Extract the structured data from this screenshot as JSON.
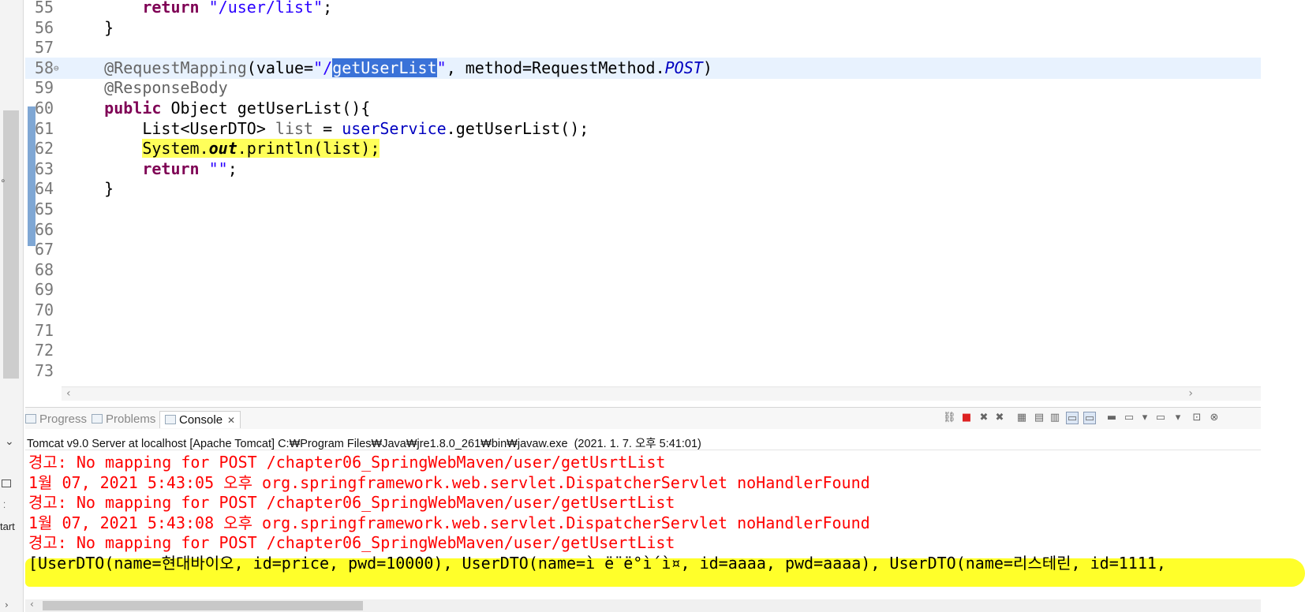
{
  "editor": {
    "lines": [
      {
        "num": "55",
        "segments": [
          {
            "t": "        ",
            "c": ""
          },
          {
            "t": "return",
            "c": "kw"
          },
          {
            "t": " ",
            "c": ""
          },
          {
            "t": "\"/user/list\"",
            "c": "str"
          },
          {
            "t": ";",
            "c": ""
          }
        ]
      },
      {
        "num": "56",
        "segments": [
          {
            "t": "    }",
            "c": ""
          }
        ]
      },
      {
        "num": "57",
        "segments": []
      },
      {
        "num": "58",
        "segments": [
          {
            "t": "    ",
            "c": ""
          },
          {
            "t": "@RequestMapping",
            "c": "ann"
          },
          {
            "t": "(value=",
            "c": ""
          },
          {
            "t": "\"/",
            "c": "str"
          },
          {
            "t": "getUserList",
            "c": "sel"
          },
          {
            "t": "\"",
            "c": "str"
          },
          {
            "t": ", method=RequestMethod.",
            "c": ""
          },
          {
            "t": "POST",
            "c": "stat"
          },
          {
            "t": ")",
            "c": ""
          }
        ]
      },
      {
        "num": "59",
        "segments": [
          {
            "t": "    ",
            "c": ""
          },
          {
            "t": "@ResponseBody",
            "c": "ann"
          }
        ]
      },
      {
        "num": "60",
        "segments": [
          {
            "t": "    ",
            "c": ""
          },
          {
            "t": "public",
            "c": "kw"
          },
          {
            "t": " Object getUserList(){",
            "c": ""
          }
        ]
      },
      {
        "num": "61",
        "segments": [
          {
            "t": "        List<UserDTO> ",
            "c": ""
          },
          {
            "t": "list",
            "c": "ann"
          },
          {
            "t": " = ",
            "c": ""
          },
          {
            "t": "userService",
            "c": "fld"
          },
          {
            "t": ".getUserList();",
            "c": ""
          }
        ]
      },
      {
        "num": "62",
        "segments": [
          {
            "t": "        ",
            "c": ""
          },
          {
            "t": "System.",
            "c": "hl-yellow"
          },
          {
            "t": "out",
            "c": "hl-yellow static-m"
          },
          {
            "t": ".println(list);",
            "c": "hl-yellow"
          }
        ]
      },
      {
        "num": "63",
        "segments": [
          {
            "t": "        ",
            "c": ""
          },
          {
            "t": "return",
            "c": "kw"
          },
          {
            "t": " ",
            "c": ""
          },
          {
            "t": "\"\"",
            "c": "str"
          },
          {
            "t": ";",
            "c": ""
          }
        ]
      },
      {
        "num": "64",
        "segments": [
          {
            "t": "    }",
            "c": ""
          }
        ]
      },
      {
        "num": "65",
        "segments": []
      },
      {
        "num": "66",
        "segments": []
      },
      {
        "num": "67",
        "segments": []
      },
      {
        "num": "68",
        "segments": []
      },
      {
        "num": "69",
        "segments": []
      },
      {
        "num": "70",
        "segments": []
      },
      {
        "num": "71",
        "segments": []
      },
      {
        "num": "72",
        "segments": []
      },
      {
        "num": "73",
        "segments": []
      }
    ],
    "current_line": "58",
    "fold_marker_line": "58",
    "fold_marker": "⊖"
  },
  "console": {
    "tabs": [
      {
        "label": "Progress",
        "active": false,
        "icon": "progress-icon"
      },
      {
        "label": "Problems",
        "active": false,
        "icon": "problems-icon"
      },
      {
        "label": "Console",
        "active": true,
        "icon": "console-icon"
      }
    ],
    "close_glyph": "✕",
    "launch_description": "Tomcat v9.0 Server at localhost [Apache Tomcat] C:₩Program Files₩Java₩jre1.8.0_261₩bin₩javaw.exe  (2021. 1. 7. 오후 5:41:01)",
    "output": [
      {
        "text": "경고: No mapping for POST /chapter06_SpringWebMaven/user/getUsrtList",
        "stream": "err"
      },
      {
        "text": "1월 07, 2021 5:43:05 오후 org.springframework.web.servlet.DispatcherServlet noHandlerFound",
        "stream": "err"
      },
      {
        "text": "경고: No mapping for POST /chapter06_SpringWebMaven/user/getUsertList",
        "stream": "err"
      },
      {
        "text": "1월 07, 2021 5:43:08 오후 org.springframework.web.servlet.DispatcherServlet noHandlerFound",
        "stream": "err"
      },
      {
        "text": "경고: No mapping for POST /chapter06_SpringWebMaven/user/getUsertList",
        "stream": "err"
      },
      {
        "text": "[UserDTO(name=현대바이오, id=price, pwd=10000), UserDTO(name=ì ë¨ë°ì´ì¤, id=aaaa, pwd=aaaa), UserDTO(name=리스테린, id=1111,",
        "stream": "out"
      }
    ],
    "toolbar_icons": [
      "remove-launch-icon",
      "terminate-icon",
      "remove-all-terminated-icon",
      "remove-all-icon",
      "clear-console-icon",
      "scroll-lock-icon",
      "word-wrap-icon",
      "show-stdout-icon",
      "show-stderr-icon",
      "pin-console-icon",
      "display-console-icon",
      "display-console-dropdown-icon",
      "open-console-icon",
      "open-console-dropdown-icon",
      "minimize-icon",
      "maximize-icon"
    ]
  },
  "left_strip": {
    "label": "tart"
  },
  "colors": {
    "stderr": "#ff0000",
    "highlight": "#ffff2a",
    "selection": "#3a72d8",
    "keyword": "#7f0055",
    "string": "#2a00ff"
  }
}
